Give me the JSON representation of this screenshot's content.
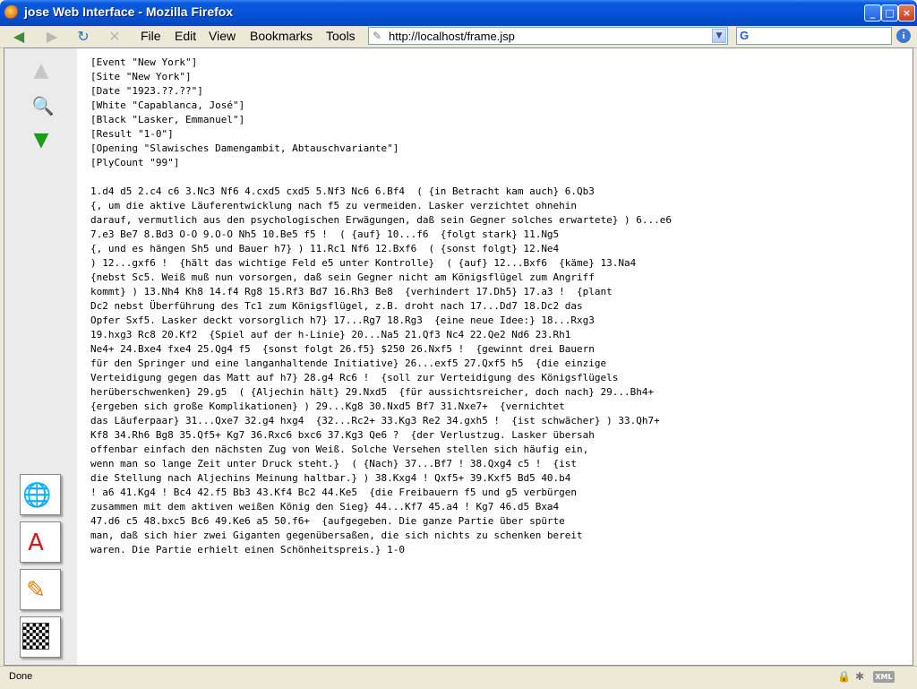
{
  "window": {
    "title": "jose Web Interface - Mozilla Firefox",
    "min_label": "_",
    "max_label": "□",
    "close_label": "×"
  },
  "toolbar": {
    "back_icon": "◀",
    "forward_icon": "▶",
    "reload_icon": "↻",
    "stop_icon": "✕",
    "menus": [
      "File",
      "Edit",
      "View",
      "Bookmarks",
      "Tools"
    ],
    "url": "http://localhost/frame.jsp",
    "page_icon": "✎",
    "drop_icon": "▼",
    "search_icon_label": "G",
    "info_icon": "i"
  },
  "sidebar": {
    "up_icon": "▲",
    "zoom_icon": "🔍",
    "down_icon": "▼",
    "docs": [
      {
        "icon": "globe-icon",
        "glyph": "🌐"
      },
      {
        "icon": "pdf-icon",
        "glyph": "A"
      },
      {
        "icon": "edit-icon",
        "glyph": "✎"
      },
      {
        "icon": "board-icon",
        "glyph": ""
      }
    ]
  },
  "pgn": {
    "text": "[Event \"New York\"]\n[Site \"New York\"]\n[Date \"1923.??.??\"]\n[White \"Capablanca, José\"]\n[Black \"Lasker, Emmanuel\"]\n[Result \"1-0\"]\n[Opening \"Slawisches Damengambit, Abtauschvariante\"]\n[PlyCount \"99\"]\n\n1.d4 d5 2.c4 c6 3.Nc3 Nf6 4.cxd5 cxd5 5.Nf3 Nc6 6.Bf4  ( {in Betracht kam auch} 6.Qb3\n{, um die aktive Läuferentwicklung nach f5 zu vermeiden. Lasker verzichtet ohnehin\ndarauf, vermutlich aus den psychologischen Erwägungen, daß sein Gegner solches erwartete} ) 6...e6\n7.e3 Be7 8.Bd3 O-O 9.O-O Nh5 10.Be5 f5 !  ( {auf} 10...f6  {folgt stark} 11.Ng5\n{, und es hängen Sh5 und Bauer h7} ) 11.Rc1 Nf6 12.Bxf6  ( {sonst folgt} 12.Ne4\n) 12...gxf6 !  {hält das wichtige Feld e5 unter Kontrolle}  ( {auf} 12...Bxf6  {käme} 13.Na4\n{nebst Sc5. Weiß muß nun vorsorgen, daß sein Gegner nicht am Königsflügel zum Angriff\nkommt} ) 13.Nh4 Kh8 14.f4 Rg8 15.Rf3 Bd7 16.Rh3 Be8  {verhindert 17.Dh5} 17.a3 !  {plant\nDc2 nebst Überführung des Tc1 zum Königsflügel, z.B. droht nach 17...Dd7 18.Dc2 das\nOpfer Sxf5. Lasker deckt vorsorglich h7} 17...Rg7 18.Rg3  {eine neue Idee:} 18...Rxg3\n19.hxg3 Rc8 20.Kf2  {Spiel auf der h-Linie} 20...Na5 21.Qf3 Nc4 22.Qe2 Nd6 23.Rh1\nNe4+ 24.Bxe4 fxe4 25.Qg4 f5  {sonst folgt 26.f5} $250 26.Nxf5 !  {gewinnt drei Bauern\nfür den Springer und eine langanhaltende Initiative} 26...exf5 27.Qxf5 h5  {die einzige\nVerteidigung gegen das Matt auf h7} 28.g4 Rc6 !  {soll zur Verteidigung des Königsflügels\nherüberschwenken} 29.g5  ( {Aljechin hält} 29.Nxd5  {für aussichtsreicher, doch nach} 29...Bh4+\n{ergeben sich große Komplikationen} ) 29...Kg8 30.Nxd5 Bf7 31.Nxe7+  {vernichtet\ndas Läuferpaar} 31...Qxe7 32.g4 hxg4  {32...Rc2+ 33.Kg3 Re2 34.gxh5 !  {ist schwächer} ) 33.Qh7+\nKf8 34.Rh6 Bg8 35.Qf5+ Kg7 36.Rxc6 bxc6 37.Kg3 Qe6 ?  {der Verlustzug. Lasker übersah\noffenbar einfach den nächsten Zug von Weiß. Solche Versehen stellen sich häufig ein,\nwenn man so lange Zeit unter Druck steht.}  ( {Nach} 37...Bf7 ! 38.Qxg4 c5 !  {ist\ndie Stellung nach Aljechins Meinung haltbar.} ) 38.Kxg4 ! Qxf5+ 39.Kxf5 Bd5 40.b4\n! a6 41.Kg4 ! Bc4 42.f5 Bb3 43.Kf4 Bc2 44.Ke5  {die Freibauern f5 und g5 verbürgen\nzusammen mit dem aktiven weißen König den Sieg} 44...Kf7 45.a4 ! Kg7 46.d5 Bxa4\n47.d6 c5 48.bxc5 Bc6 49.Ke6 a5 50.f6+  {aufgegeben. Die ganze Partie über spürte\nman, daß sich hier zwei Giganten gegenübersaßen, die sich nichts zu schenken bereit\nwaren. Die Partie erhielt einen Schönheitspreis.} 1-0"
  },
  "status": {
    "text": "Done",
    "lock_icon": "🔒",
    "block_icon": "✱",
    "xml_label": "XML"
  }
}
